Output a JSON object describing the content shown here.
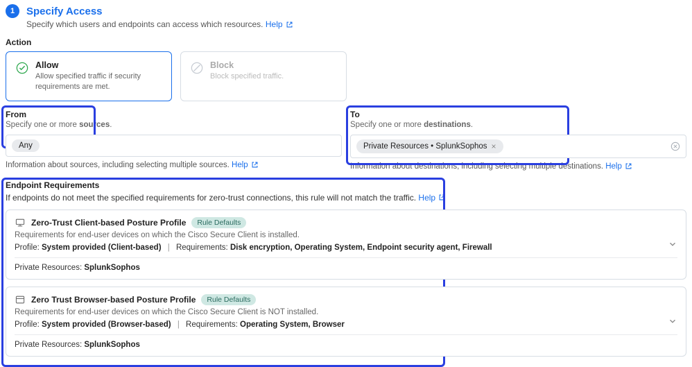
{
  "step": {
    "number": "1",
    "title": "Specify Access",
    "subtitle": "Specify which users and endpoints can access which resources.",
    "help": "Help"
  },
  "action": {
    "label": "Action",
    "allow": {
      "title": "Allow",
      "desc": "Allow specified traffic if security requirements are met."
    },
    "block": {
      "title": "Block",
      "desc": "Block specified traffic."
    }
  },
  "from": {
    "label": "From",
    "hint_pre": "Specify one or more ",
    "hint_strong": "sources",
    "chip": "Any",
    "helptext": "Information about sources, including selecting multiple sources.",
    "help": "Help"
  },
  "to": {
    "label": "To",
    "hint_pre": "Specify one or more ",
    "hint_strong": "destinations",
    "chip": "Private Resources • SplunkSophos",
    "helptext": "Information about destinations, including selecting multiple destinations.",
    "help": "Help"
  },
  "endpoint": {
    "label": "Endpoint Requirements",
    "desc": "If endpoints do not meet the specified requirements for zero-trust connections, this rule will not match the traffic.",
    "help": "Help"
  },
  "profiles": {
    "client": {
      "title": "Zero-Trust Client-based Posture Profile",
      "badge": "Rule Defaults",
      "desc": "Requirements for end-user devices on which the Cisco Secure Client is installed.",
      "profile_label": "Profile:",
      "profile_value": "System provided (Client-based)",
      "req_label": "Requirements:",
      "req_value": "Disk encryption, Operating System, Endpoint security agent, Firewall",
      "res_label": "Private Resources:",
      "res_value": "SplunkSophos"
    },
    "browser": {
      "title": "Zero Trust Browser-based Posture Profile",
      "badge": "Rule Defaults",
      "desc": "Requirements for end-user devices on which the Cisco Secure Client is NOT installed.",
      "profile_label": "Profile:",
      "profile_value": "System provided (Browser-based)",
      "req_label": "Requirements:",
      "req_value": "Operating System, Browser",
      "res_label": "Private Resources:",
      "res_value": "SplunkSophos"
    }
  }
}
